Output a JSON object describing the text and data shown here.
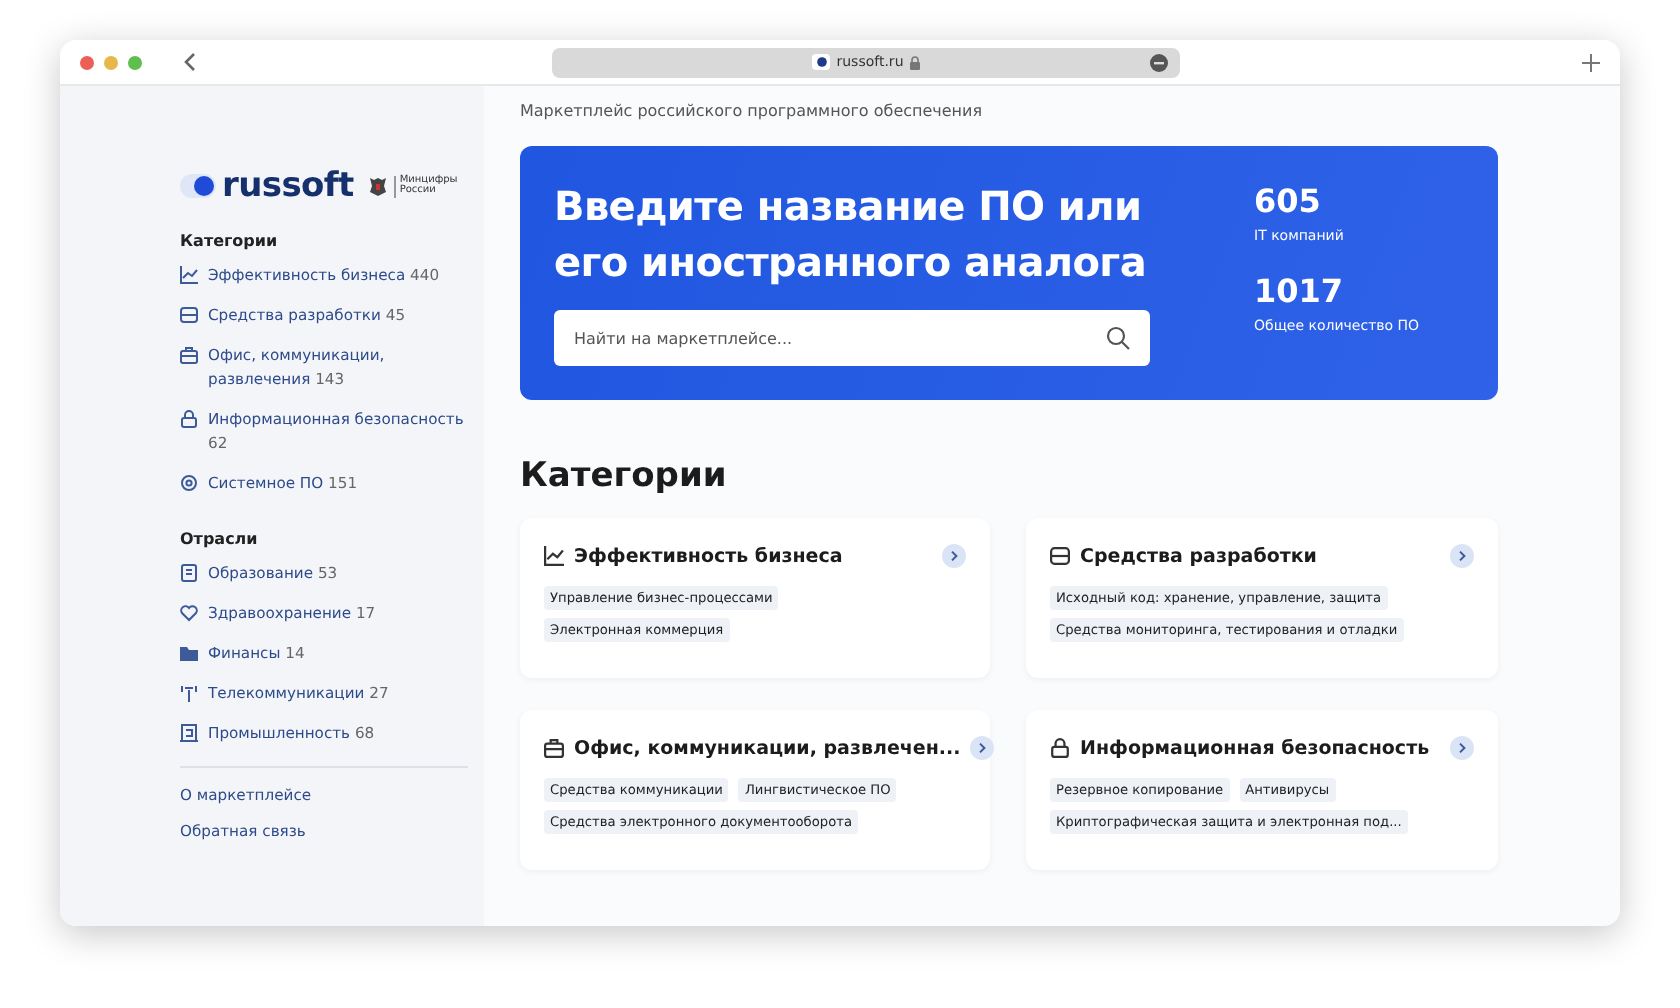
{
  "browser": {
    "url": "russoft.ru"
  },
  "sidebar": {
    "logo": {
      "name": "russoft",
      "partner": "Минцифры России"
    },
    "categories_title": "Категории",
    "categories": [
      {
        "label": "Эффективность бизнеса",
        "count": "440"
      },
      {
        "label": "Средства разработки",
        "count": "45"
      },
      {
        "label": "Офис, коммуникации, развлечения",
        "count": "143"
      },
      {
        "label": "Информационная безопасность",
        "count": "62"
      },
      {
        "label": "Системное ПО",
        "count": "151"
      }
    ],
    "industries_title": "Отрасли",
    "industries": [
      {
        "label": "Образование",
        "count": "53"
      },
      {
        "label": "Здравоохранение",
        "count": "17"
      },
      {
        "label": "Финансы",
        "count": "14"
      },
      {
        "label": "Телекоммуникации",
        "count": "27"
      },
      {
        "label": "Промышленность",
        "count": "68"
      }
    ],
    "links": [
      "О маркетплейсе",
      "Обратная связь"
    ]
  },
  "main": {
    "subtitle": "Маркетплейс российского программного обеспечения",
    "banner": {
      "title": "Введите название ПО или его иностранного аналога",
      "search_placeholder": "Найти на маркетплейсе...",
      "stats": [
        {
          "value": "605",
          "label": "IT компаний"
        },
        {
          "value": "1017",
          "label": "Общее количество ПО"
        }
      ]
    },
    "categories_title": "Категории",
    "cards": [
      {
        "title": "Эффективность бизнеса",
        "tags": [
          "Управление бизнес-процессами",
          "Электронная коммерция"
        ]
      },
      {
        "title": "Средства разработки",
        "tags": [
          "Исходный код: хранение, управление, защита",
          "Средства мониторинга, тестирования и отладки"
        ]
      },
      {
        "title": "Офис, коммуникации, развлечен...",
        "tags": [
          "Средства коммуникации",
          "Лингвистическое ПО",
          "Средства электронного документооборота"
        ]
      },
      {
        "title": "Информационная безопасность",
        "tags": [
          "Резервное копирование",
          "Антивирусы",
          "Криптографическая защита и электронная под..."
        ]
      }
    ]
  }
}
